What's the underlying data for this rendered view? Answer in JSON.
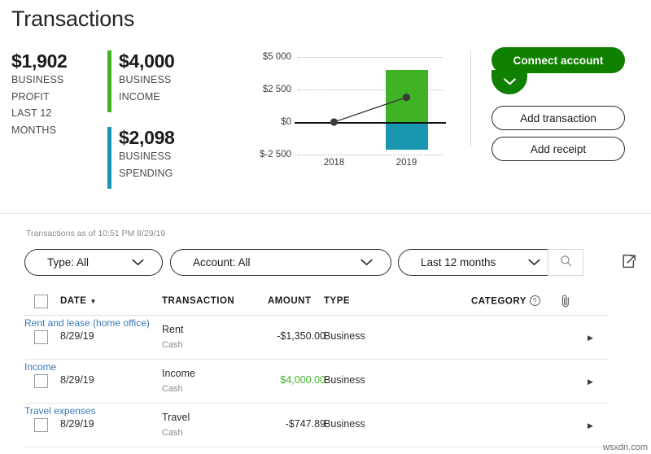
{
  "page_title": "Transactions",
  "summary": {
    "profit": {
      "value": "$1,902",
      "label_lines": [
        "BUSINESS",
        "PROFIT",
        "LAST 12",
        "MONTHS"
      ],
      "bar_color": "transparent"
    },
    "income": {
      "value": "$4,000",
      "label_lines": [
        "BUSINESS",
        "INCOME"
      ],
      "bar_color": "#3fb324"
    },
    "spending": {
      "value": "$2,098",
      "label_lines": [
        "BUSINESS",
        "SPENDING"
      ],
      "bar_color": "#1a97b0"
    }
  },
  "chart_data": {
    "type": "bar",
    "title": "",
    "xlabel": "",
    "ylabel": "",
    "categories": [
      "2018",
      "2019"
    ],
    "ytick_labels": [
      "$5 000",
      "$2 500",
      "$0",
      "$-2 500"
    ],
    "ytick_values": [
      5000,
      2500,
      0,
      -2500
    ],
    "ylim": [
      -2500,
      5000
    ],
    "grid": true,
    "legend_position": "none",
    "series": [
      {
        "name": "Business income",
        "type": "bar",
        "color": "#3fb324",
        "values": [
          0,
          4000
        ]
      },
      {
        "name": "Business spending",
        "type": "bar",
        "color": "#1a97b0",
        "values": [
          0,
          -2098
        ]
      },
      {
        "name": "Business profit",
        "type": "line",
        "color": "#3b3b3b",
        "values": [
          0,
          1902
        ]
      }
    ]
  },
  "actions": {
    "connect_account": "Connect account",
    "connect_caret_icon": "chevron-down-icon",
    "add_transaction": "Add transaction",
    "add_receipt": "Add receipt"
  },
  "filters": {
    "as_of": "Transactions as of 10:51 PM 8/29/19",
    "type": {
      "label": "Type: All",
      "caret_icon": "chevron-down-icon"
    },
    "account": {
      "label": "Account: All",
      "caret_icon": "chevron-down-icon"
    },
    "date_range": {
      "label": "Last 12 months",
      "caret_icon": "chevron-down-icon"
    },
    "search_icon": "search-icon",
    "export_icon": "export-icon"
  },
  "table": {
    "headers": {
      "date": "DATE",
      "date_sort_icon": "sort-descending-icon",
      "transaction": "TRANSACTION",
      "amount": "AMOUNT",
      "type": "TYPE",
      "category": "CATEGORY",
      "category_help_icon": "help-circle-icon",
      "attachment_icon": "paperclip-icon"
    },
    "rows": [
      {
        "date": "8/29/19",
        "transaction": "Rent",
        "source": "Cash",
        "amount": "-$1,350.00",
        "amount_positive": false,
        "type": "Business",
        "category": "Rent and lease (home office)",
        "arrow_icon": "chevron-right-icon"
      },
      {
        "date": "8/29/19",
        "transaction": "Income",
        "source": "Cash",
        "amount": "$4,000.00",
        "amount_positive": true,
        "type": "Business",
        "category": "Income",
        "arrow_icon": "chevron-right-icon"
      },
      {
        "date": "8/29/19",
        "transaction": "Travel",
        "source": "Cash",
        "amount": "-$747.89",
        "amount_positive": false,
        "type": "Business",
        "category": "Travel expenses",
        "arrow_icon": "chevron-right-icon"
      }
    ]
  },
  "watermark": "wsxdn.com",
  "colors": {
    "brand_green": "#108000",
    "income_green": "#3fb324",
    "spending_teal": "#1a97b0",
    "amount_positive": "#42b72a",
    "link_blue": "#3a78b5"
  }
}
